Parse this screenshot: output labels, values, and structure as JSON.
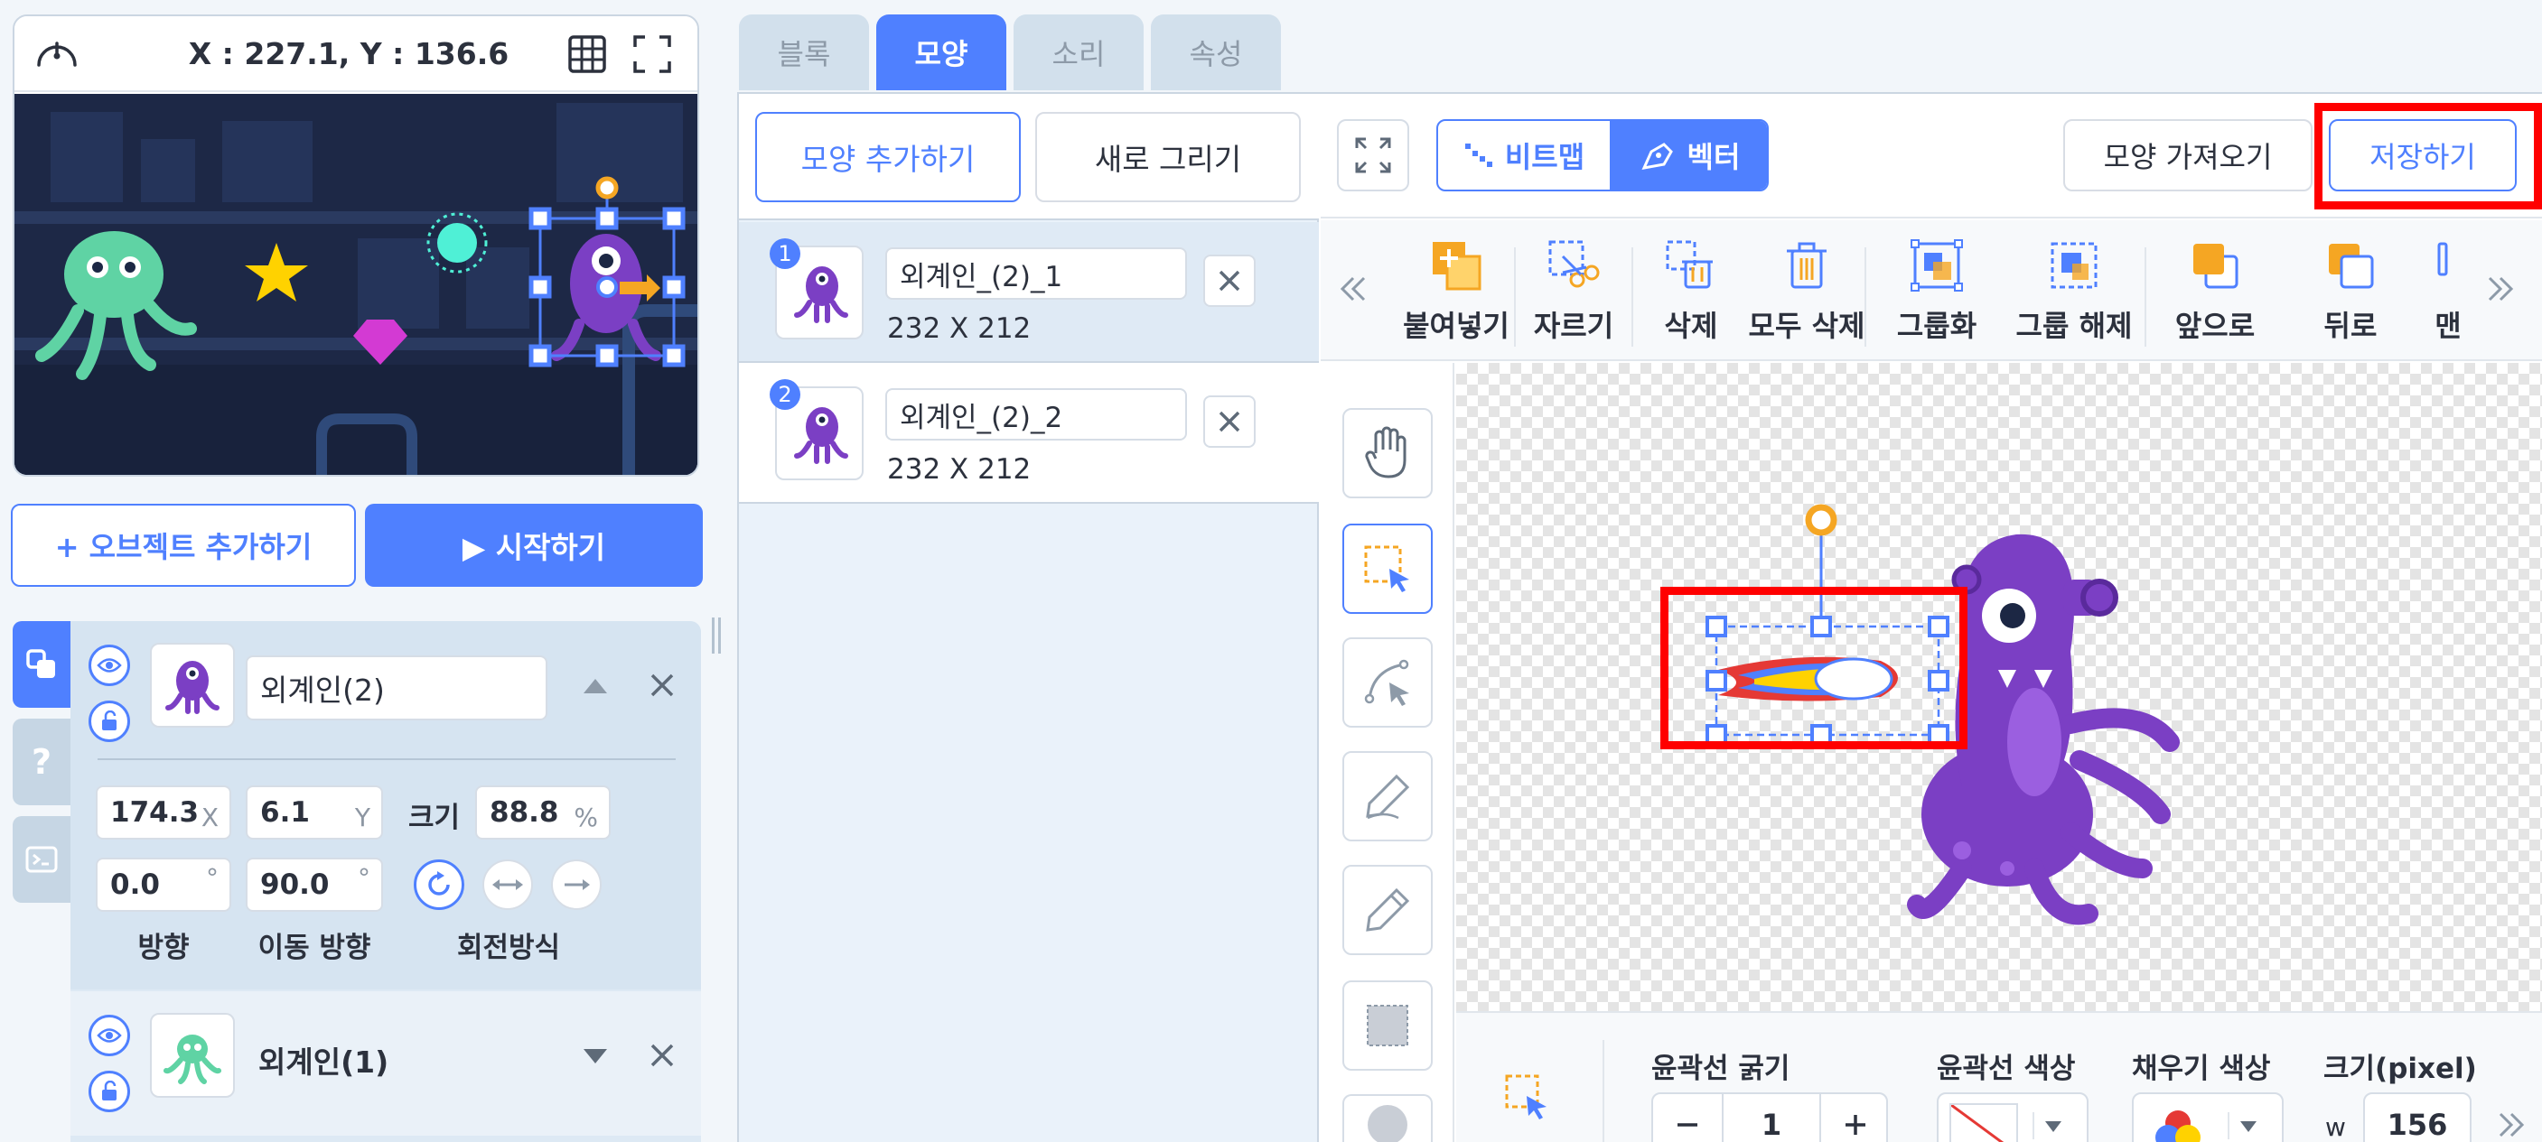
{
  "stage": {
    "coords": "X : 227.1, Y : 136.6"
  },
  "stage_buttons": {
    "add_object": "+ 오브젝트 추가하기",
    "start": "▶ 시작하기"
  },
  "objects": [
    {
      "name": "외계인(2)",
      "x": "174.3",
      "x_unit": "X",
      "y": "6.1",
      "y_unit": "Y",
      "size_label": "크기",
      "size": "88.8",
      "size_unit": "%",
      "direction": "0.0",
      "move_direction": "90.0",
      "direction_unit": "°",
      "direction_label": "방향",
      "move_direction_label": "이동 방향",
      "rotation_label": "회전방식"
    },
    {
      "name": "외계인(1)"
    }
  ],
  "side_tabs": [
    "?"
  ],
  "tabs": [
    "블록",
    "모양",
    "소리",
    "속성"
  ],
  "costume_panel": {
    "add_button": "모양 추가하기",
    "draw_button": "새로 그리기",
    "costumes": [
      {
        "index": "1",
        "name": "외계인_(2)_1",
        "size": "232 X 212"
      },
      {
        "index": "2",
        "name": "외계인_(2)_2",
        "size": "232 X 212"
      }
    ]
  },
  "editor": {
    "bitmap": "비트맵",
    "vector": "벡터",
    "import": "모양 가져오기",
    "save": "저장하기",
    "toolbar": [
      "붙여넣기",
      "자르기",
      "삭제",
      "모두 삭제",
      "그룹화",
      "그룹 해제",
      "앞으로",
      "뒤로",
      "맨"
    ],
    "props": {
      "stroke_width_label": "윤곽선 굵기",
      "stroke_width": "1",
      "stroke_color_label": "윤곽선 색상",
      "fill_color_label": "채우기 색상",
      "size_label": "크기(pixel)",
      "w_label": "w",
      "w_value": "156"
    }
  },
  "colors": {
    "accent": "#4f80ff",
    "highlight": "#ff0000",
    "alien_purple": "#7b3fc4",
    "alien_green": "#5fd3a4"
  }
}
